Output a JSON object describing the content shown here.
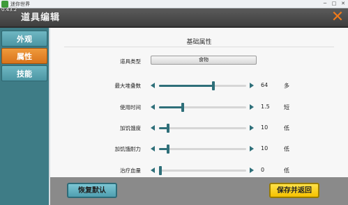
{
  "os": {
    "title": "迷你世界",
    "version": "0.43.2"
  },
  "header": {
    "title": "道具编辑"
  },
  "tabs": [
    {
      "label": "外观",
      "active": false
    },
    {
      "label": "属性",
      "active": true
    },
    {
      "label": "技能",
      "active": false
    }
  ],
  "section": {
    "title": "基础属性"
  },
  "item_type": {
    "label": "道具类型",
    "value": "食物"
  },
  "sliders": [
    {
      "label": "最大堆叠数",
      "value": "64",
      "unit": "多",
      "level": 0.62
    },
    {
      "label": "使用时间",
      "value": "1.5",
      "unit": "短",
      "level": 0.27
    },
    {
      "label": "加饥饿度",
      "value": "10",
      "unit": "低",
      "level": 0.1
    },
    {
      "label": "加饥饿耐力",
      "value": "10",
      "unit": "低",
      "level": 0.1
    },
    {
      "label": "治疗血量",
      "value": "0",
      "unit": "低",
      "level": 0.0
    }
  ],
  "buttons": {
    "reset": "恢复默认",
    "save": "保存并返回"
  },
  "colors": {
    "accent": "#2e6f79",
    "active_tab": "#e5842a",
    "save_button": "#f5c200",
    "close_icon": "#f07a1b"
  }
}
